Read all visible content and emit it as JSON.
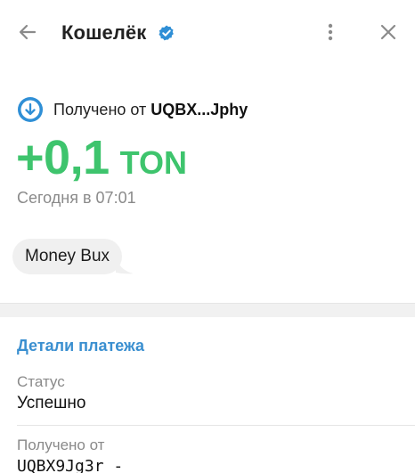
{
  "header": {
    "title": "Кошелёк",
    "back_icon": "arrow-left-icon",
    "verified_icon": "verified-badge-icon",
    "more_icon": "vertical-dots-icon",
    "close_icon": "close-icon"
  },
  "transaction": {
    "direction_icon": "arrow-down-circle-icon",
    "received_label": "Получено от",
    "from_short": "UQBX...Jphy",
    "amount": "+0,1",
    "currency": "TON",
    "date": "Сегодня в 07:01",
    "comment": "Money Bux"
  },
  "details": {
    "title": "Детали платежа",
    "status_label": "Статус",
    "status_value": "Успешно",
    "from_label": "Получено от",
    "from_value": "UQBX9Jg3r -"
  },
  "colors": {
    "accent_green": "#3ec46d",
    "link_blue": "#3a8fd0",
    "icon_blue": "#2f8fd6",
    "muted_text": "#8a8a8a"
  }
}
